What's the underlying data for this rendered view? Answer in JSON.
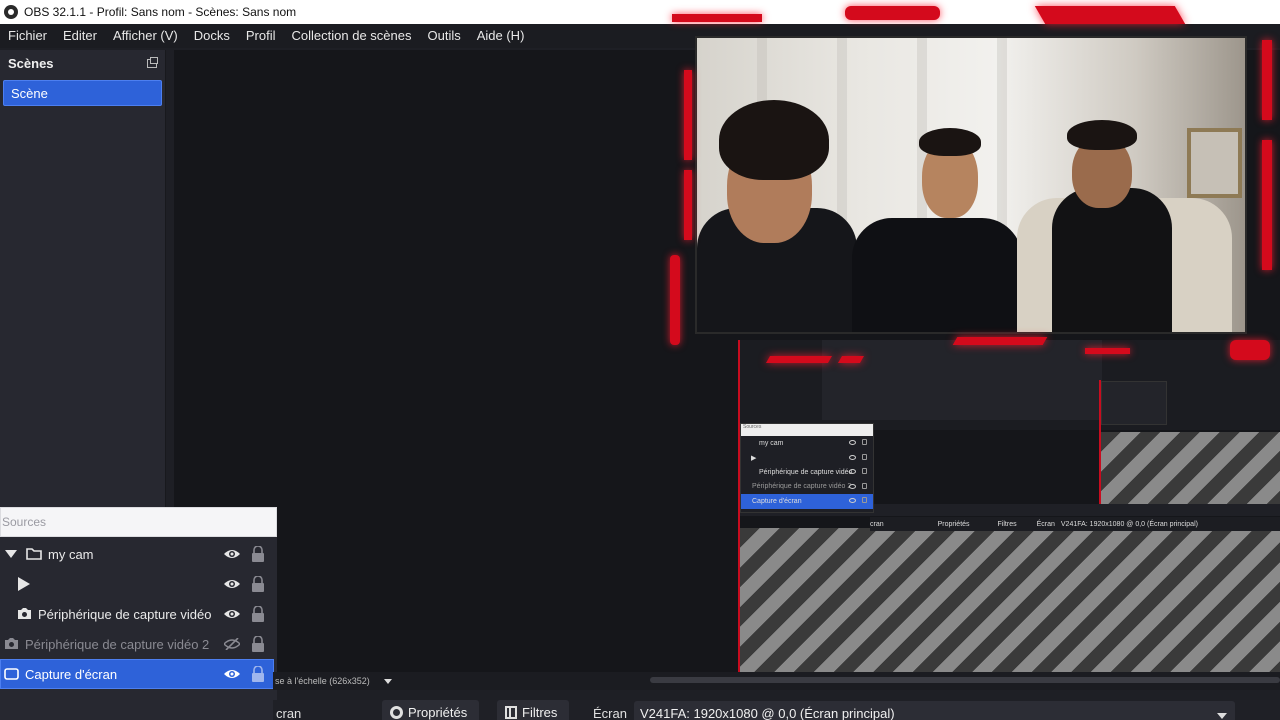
{
  "window": {
    "title": "OBS 32.1.1 - Profil: Sans nom - Scènes: Sans nom"
  },
  "menu": {
    "items": [
      "Fichier",
      "Editer",
      "Afficher (V)",
      "Docks",
      "Profil",
      "Collection de scènes",
      "Outils",
      "Aide (H)"
    ]
  },
  "scenes": {
    "title": "Scènes",
    "items": [
      {
        "label": "Scène",
        "selected": true
      }
    ]
  },
  "sources": {
    "header": "Sources",
    "items": [
      {
        "label": "my cam",
        "type": "group",
        "visible": true,
        "locked": false
      },
      {
        "label": "",
        "type": "media",
        "visible": true,
        "locked": false
      },
      {
        "label": "Périphérique de capture vidéo",
        "type": "camera",
        "visible": true,
        "locked": false
      },
      {
        "label": "Périphérique de capture vidéo 2",
        "type": "camera",
        "visible": false,
        "locked": false
      },
      {
        "label": "Capture d'écran",
        "type": "display",
        "visible": true,
        "locked": false,
        "selected": true
      }
    ]
  },
  "preview": {
    "scale_label": "se à l'échelle (626x352)",
    "nested": {
      "sources_header": "Sources",
      "items": [
        "my cam",
        "",
        "Périphérique de capture vidéo",
        "Périphérique de capture vidéo 2",
        "Capture d'écran"
      ],
      "toolbar_left": "cran",
      "toolbar_props": "Propriétés",
      "toolbar_filters": "Filtres",
      "toolbar_label": "Écran",
      "toolbar_value": "V241FA: 1920x1080 @ 0,0 (Écran principal)",
      "scale_label": "se à l'échelle (626x352)"
    }
  },
  "toolbar": {
    "cut_label": "cran",
    "properties_label": "Propriétés",
    "filters_label": "Filtres",
    "display_label": "Écran",
    "display_value": "V241FA: 1920x1080 @ 0,0 (Écran principal)"
  },
  "colors": {
    "selection": "#2e62d9",
    "accent_red": "#d40a1c",
    "dock_bg": "#272830",
    "preview_bg": "#15161a"
  }
}
